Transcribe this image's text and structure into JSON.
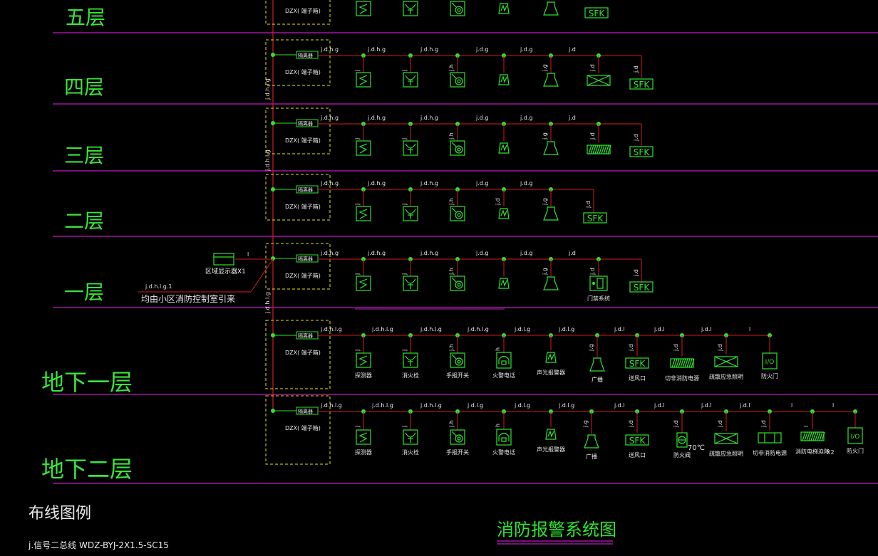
{
  "colors": {
    "background": "#000000",
    "floor_line": "#c21bc2",
    "wire": "#d91a1a",
    "device": "#2de52d",
    "text": "#e8e8e8",
    "junction_box_dash": "#e6e600"
  },
  "floors": [
    {
      "label": "五层"
    },
    {
      "label": "四层"
    },
    {
      "label": "三层"
    },
    {
      "label": "二层"
    },
    {
      "label": "一层"
    },
    {
      "label": "地下一层"
    },
    {
      "label": "地下二层"
    }
  ],
  "junction_box": {
    "isolator_label": "隔离器",
    "terminal_label": "DZX( 端子箱)"
  },
  "riser_labels": [
    "j.d.h.l.g",
    "j.d.h.l.g",
    "j.d.h.l.g"
  ],
  "first_floor": {
    "display_label": "区域显示器X1",
    "feed_code": "j.d.h.l.g.1",
    "feed_note": "均由小区消防控制室引来",
    "display_wire": "l"
  },
  "wire_codes": {
    "jdhg": "j.d.h.g",
    "jdg": "j.d.g",
    "jd": "j.d",
    "jdhlg": "j.d.h.l.g",
    "jdlg": "j.d.l.g",
    "jdl": "j.d.l",
    "l": "l",
    "j": "j",
    "jh": "j.h",
    "h": "h",
    "jg": "j.g"
  },
  "device_names": {
    "detector": "探测器",
    "hydrant": "消火栓",
    "manual_switch": "手报开关",
    "fire_phone": "火警电话",
    "sound_light": "声光报警器",
    "broadcast": "广播",
    "air_vent": "送风口",
    "cut_power": "切非消防电源",
    "emergency_light": "疏散应急照明",
    "fire_door": "防火门",
    "access_control": "门禁系统",
    "fire_valve": "防火阀",
    "cut_power2": "切非消防电源",
    "elevator": "消防电梯迫降",
    "fire_door2": "防火门"
  },
  "device_text": {
    "sfk": "SFK",
    "io": "I/O",
    "temp": "70℃",
    "x2": "X2"
  },
  "legend": {
    "title": "布线图例",
    "line1": "j.信号二总线    WDZ-BYJ-2X1.5-SC15"
  },
  "diagram_title": "消防报警系统图"
}
